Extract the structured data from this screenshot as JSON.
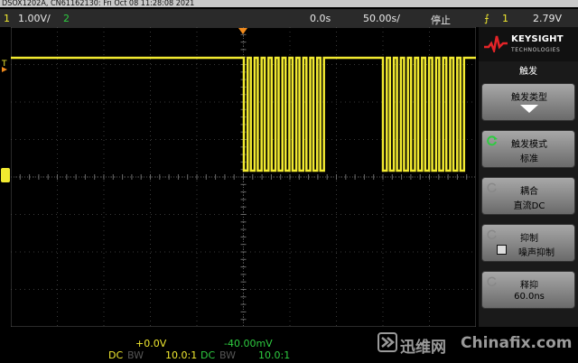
{
  "title": "DSOX1202A, CN61162130: Fri Oct 08 11:28:08 2021",
  "status": {
    "ch1_num": "1",
    "ch1_scale": "1.00V/",
    "ch2_num": "2",
    "time_pos": "0.0s",
    "time_scale": "50.00s/",
    "run_state": "停止",
    "trig_slope": "⨍",
    "trig_src": "1",
    "trig_level": "2.79V"
  },
  "markers": {
    "trigger_level": "T"
  },
  "bottom": {
    "ch1_offset": "+0.0V",
    "ch1_coupling": "DC",
    "ch1_bw": "BW",
    "ch1_probe": "10.0:1",
    "ch2_offset": "-40.00mV",
    "ch2_coupling": "DC",
    "ch2_bw": "BW",
    "ch2_probe": "10.0:1"
  },
  "side": {
    "brand": "KEYSIGHT",
    "brand_sub": "TECHNOLOGIES",
    "menu_title": "触发",
    "keys": [
      {
        "label": "触发类型",
        "value": ""
      },
      {
        "label": "触发模式",
        "value": "标准"
      },
      {
        "label": "耦合",
        "value": "直流DC"
      },
      {
        "label": "抑制",
        "value": "噪声抑制"
      },
      {
        "label": "释抑",
        "value": "60.0ns"
      }
    ]
  },
  "watermark": {
    "cn": "迅维网",
    "en": "Chinafix.com"
  },
  "colors": {
    "ch1": "#f2ea30",
    "ch2": "#2ecc40",
    "trigger_orange": "#f08a1c"
  }
}
